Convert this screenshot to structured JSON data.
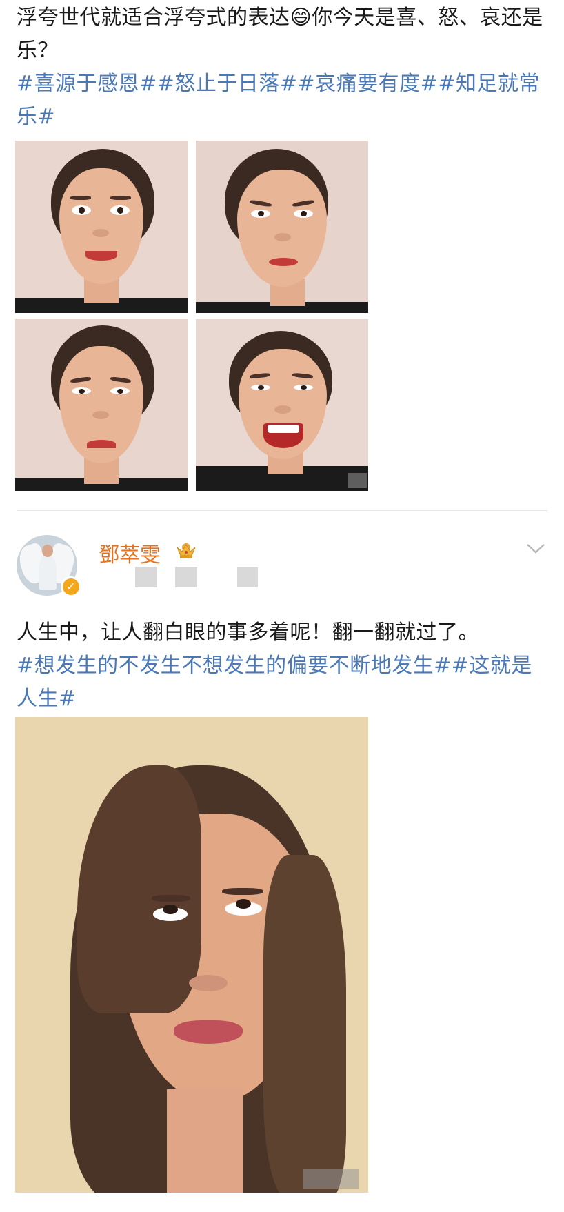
{
  "post1": {
    "text": "浮夸世代就适合浮夸式的表达😄你今天是喜、怒、哀还是乐？",
    "hashtags": "#喜源于感恩##怒止于日落##哀痛要有度##知足就常乐#",
    "photos": [
      "happy-face-photo",
      "angry-face-photo",
      "sad-face-photo",
      "joyful-face-photo"
    ]
  },
  "post2": {
    "username": "鄧萃雯",
    "text": "人生中，让人翻白眼的事多着呢！翻一翻就过了。",
    "hashtags": "#想发生的不发生不想发生的偏要不断地发生##这就是人生#",
    "photo": "eye-roll-photo"
  },
  "icons": {
    "crown": "crown-icon",
    "verified": "verified-badge-icon",
    "menu": "chevron-down-icon"
  },
  "colors": {
    "hashtag": "#4b79b8",
    "username": "#e5711c",
    "verified": "#f4a71b"
  }
}
